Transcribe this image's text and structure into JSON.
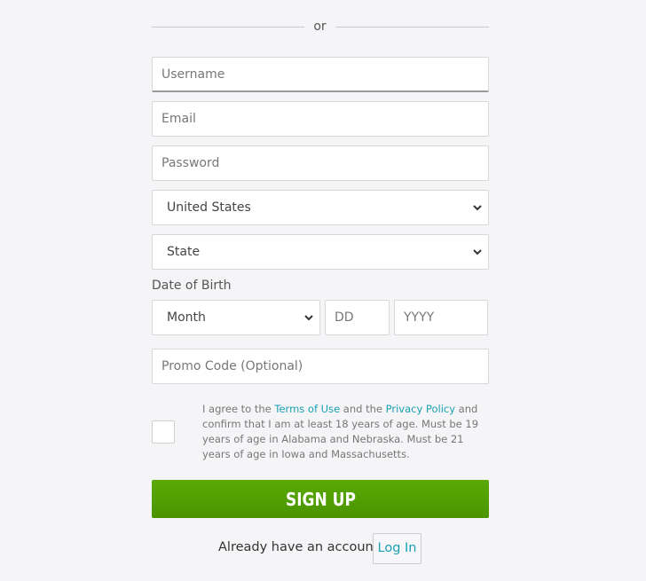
{
  "divider": {
    "text": "or"
  },
  "fields": {
    "username": {
      "placeholder": "Username",
      "value": ""
    },
    "email": {
      "placeholder": "Email",
      "value": ""
    },
    "password": {
      "placeholder": "Password",
      "value": ""
    },
    "country": {
      "selected": "United States"
    },
    "state": {
      "selected": "State"
    },
    "dob": {
      "label": "Date of Birth",
      "month": {
        "selected": "Month"
      },
      "day": {
        "placeholder": "DD",
        "value": ""
      },
      "year": {
        "placeholder": "YYYY",
        "value": ""
      }
    },
    "promo": {
      "placeholder": "Promo Code (Optional)",
      "value": ""
    }
  },
  "terms": {
    "checked": false,
    "prefix": "I agree to the ",
    "terms_link": "Terms of Use",
    "middle": " and the ",
    "privacy_link": "Privacy Policy",
    "suffix": " and confirm that I am at least 18 years of age. Must be 19 years of age in Alabama and Nebraska. Must be 21 years of age in Iowa and Massachusetts."
  },
  "signup_button": {
    "label": "SIGN UP"
  },
  "login_prompt": {
    "text": "Already have an account?",
    "button_label": "Log In"
  },
  "colors": {
    "accent_link": "#1a9fb3",
    "signup_green_top": "#5aaa06",
    "signup_green_bottom": "#4a9400",
    "background": "#f5f5f7"
  }
}
